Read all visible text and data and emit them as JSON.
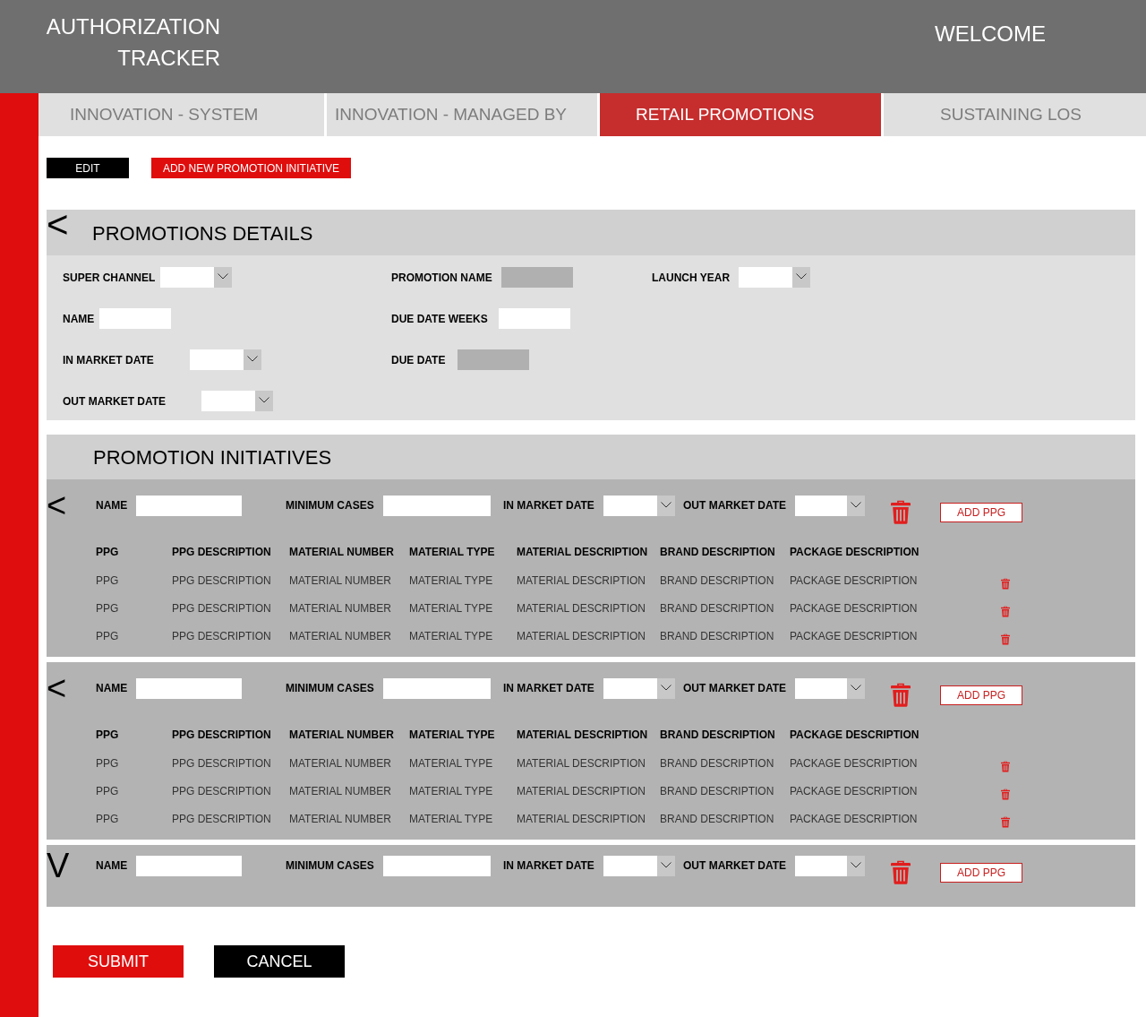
{
  "header": {
    "title": "AUTHORIZATION TRACKER",
    "welcome": "WELCOME"
  },
  "tabs": [
    {
      "label": "INNOVATION - SYSTEM",
      "selected": false
    },
    {
      "label": "INNOVATION - MANAGED BY",
      "selected": false
    },
    {
      "label": "RETAIL PROMOTIONS",
      "selected": true
    },
    {
      "label": "SUSTAINING LOS",
      "selected": false
    }
  ],
  "toolbar": [
    {
      "label": "EDIT",
      "kind": "dark"
    },
    {
      "label": "ADD NEW PROMOTION INITIATIVE",
      "kind": "primary"
    }
  ],
  "promotions_details": {
    "toggle": "<",
    "title": "PROMOTIONS DETAILS",
    "columns": [
      {
        "fields": [
          {
            "label": "SUPER CHANNEL",
            "kind": "dropdown",
            "disabled": false
          },
          {
            "label": "NAME",
            "kind": "text",
            "disabled": false
          },
          {
            "label": "IN MARKET DATE",
            "kind": "dropdown",
            "disabled": false
          },
          {
            "label": "OUT MARKET DATE",
            "kind": "dropdown",
            "disabled": false
          }
        ]
      },
      {
        "fields": [
          {
            "label": "PROMOTION NAME",
            "kind": "text",
            "disabled": true
          },
          {
            "label": "DUE DATE WEEKS",
            "kind": "text",
            "disabled": false
          },
          {
            "label": "DUE DATE",
            "kind": "text",
            "disabled": true
          }
        ]
      },
      {
        "fields": [
          {
            "label": "LAUNCH YEAR",
            "kind": "dropdown",
            "disabled": false
          }
        ]
      }
    ]
  },
  "promotion_initiatives": {
    "title": "PROMOTION INITIATIVES",
    "items": [
      {
        "toggle": "<",
        "expanded": true,
        "fields": [
          {
            "label": "NAME",
            "kind": "text"
          },
          {
            "label": "MINIMUM CASES",
            "kind": "text"
          },
          {
            "label": "IN MARKET DATE",
            "kind": "dropdown"
          },
          {
            "label": "OUT MARKET DATE",
            "kind": "dropdown"
          }
        ],
        "add_button": "ADD PPG",
        "table": {
          "columns": [
            "PPG",
            "PPG DESCRIPTION",
            "MATERIAL NUMBER",
            "MATERIAL TYPE",
            "MATERIAL DESCRIPTION",
            "BRAND DESCRIPTION",
            "PACKAGE DESCRIPTION"
          ],
          "rows": [
            {
              "cells": [
                "PPG",
                "PPG DESCRIPTION",
                "MATERIAL NUMBER",
                "MATERIAL TYPE",
                "MATERIAL DESCRIPTION",
                "BRAND DESCRIPTION",
                "PACKAGE DESCRIPTION"
              ]
            },
            {
              "cells": [
                "PPG",
                "PPG DESCRIPTION",
                "MATERIAL NUMBER",
                "MATERIAL TYPE",
                "MATERIAL DESCRIPTION",
                "BRAND DESCRIPTION",
                "PACKAGE DESCRIPTION"
              ]
            },
            {
              "cells": [
                "PPG",
                "PPG DESCRIPTION",
                "MATERIAL NUMBER",
                "MATERIAL TYPE",
                "MATERIAL DESCRIPTION",
                "BRAND DESCRIPTION",
                "PACKAGE DESCRIPTION"
              ]
            }
          ]
        }
      },
      {
        "toggle": "<",
        "expanded": true,
        "fields": [
          {
            "label": "NAME",
            "kind": "text"
          },
          {
            "label": "MINIMUM CASES",
            "kind": "text"
          },
          {
            "label": "IN MARKET DATE",
            "kind": "dropdown"
          },
          {
            "label": "OUT MARKET DATE",
            "kind": "dropdown"
          }
        ],
        "add_button": "ADD PPG",
        "table": {
          "columns": [
            "PPG",
            "PPG DESCRIPTION",
            "MATERIAL NUMBER",
            "MATERIAL TYPE",
            "MATERIAL DESCRIPTION",
            "BRAND DESCRIPTION",
            "PACKAGE DESCRIPTION"
          ],
          "rows": [
            {
              "cells": [
                "PPG",
                "PPG DESCRIPTION",
                "MATERIAL NUMBER",
                "MATERIAL TYPE",
                "MATERIAL DESCRIPTION",
                "BRAND DESCRIPTION",
                "PACKAGE DESCRIPTION"
              ]
            },
            {
              "cells": [
                "PPG",
                "PPG DESCRIPTION",
                "MATERIAL NUMBER",
                "MATERIAL TYPE",
                "MATERIAL DESCRIPTION",
                "BRAND DESCRIPTION",
                "PACKAGE DESCRIPTION"
              ]
            },
            {
              "cells": [
                "PPG",
                "PPG DESCRIPTION",
                "MATERIAL NUMBER",
                "MATERIAL TYPE",
                "MATERIAL DESCRIPTION",
                "BRAND DESCRIPTION",
                "PACKAGE DESCRIPTION"
              ]
            }
          ]
        }
      },
      {
        "toggle": "V",
        "expanded": false,
        "fields": [
          {
            "label": "NAME",
            "kind": "text"
          },
          {
            "label": "MINIMUM CASES",
            "kind": "text"
          },
          {
            "label": "IN MARKET DATE",
            "kind": "dropdown"
          },
          {
            "label": "OUT MARKET DATE",
            "kind": "dropdown"
          }
        ],
        "add_button": "ADD PPG"
      }
    ]
  },
  "footer_buttons": [
    {
      "label": "SUBMIT",
      "kind": "primary"
    },
    {
      "label": "CANCEL",
      "kind": "dark"
    }
  ]
}
